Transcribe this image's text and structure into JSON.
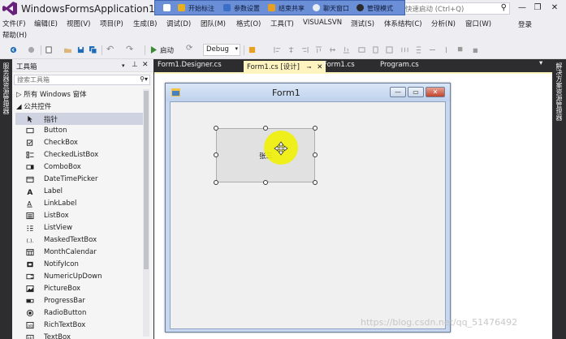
{
  "window": {
    "app_title": "WindowsFormsApplication1 - Mic",
    "quick_launch_placeholder": "快速启动 (Ctrl+Q)"
  },
  "overlay_toolbar": {
    "items": [
      "开始标注",
      "参数设置",
      "结束共享",
      "聊天窗口",
      "管理模式"
    ],
    "color": "#6b8fd6"
  },
  "menubar": {
    "items": [
      "文件(F)",
      "编辑(E)",
      "视图(V)",
      "项目(P)",
      "生成(B)",
      "调试(D)",
      "团队(M)",
      "格式(O)",
      "工具(T)",
      "VISUALSVN",
      "测试(S)",
      "体系结构(C)",
      "分析(N)",
      "窗口(W)"
    ],
    "help": "帮助(H)",
    "login": "登录"
  },
  "toolbar": {
    "start_label": "启动",
    "config_value": "Debug"
  },
  "left_strip": {
    "label": "服务器资源管理器"
  },
  "right_strip": {
    "label": "解决方案资源管理器"
  },
  "toolbox": {
    "title": "工具箱",
    "search_placeholder": "搜索工具箱",
    "categories": [
      "所有 Windows 窗体",
      "公共控件"
    ],
    "items": [
      {
        "label": "指针",
        "icon": "pointer-icon"
      },
      {
        "label": "Button",
        "icon": "button-icon"
      },
      {
        "label": "CheckBox",
        "icon": "checkbox-icon"
      },
      {
        "label": "CheckedListBox",
        "icon": "checkedlistbox-icon"
      },
      {
        "label": "ComboBox",
        "icon": "combobox-icon"
      },
      {
        "label": "DateTimePicker",
        "icon": "datetimepicker-icon"
      },
      {
        "label": "Label",
        "icon": "label-icon"
      },
      {
        "label": "LinkLabel",
        "icon": "linklabel-icon"
      },
      {
        "label": "ListBox",
        "icon": "listbox-icon"
      },
      {
        "label": "ListView",
        "icon": "listview-icon"
      },
      {
        "label": "MaskedTextBox",
        "icon": "maskedtextbox-icon"
      },
      {
        "label": "MonthCalendar",
        "icon": "monthcalendar-icon"
      },
      {
        "label": "NotifyIcon",
        "icon": "notifyicon-icon"
      },
      {
        "label": "NumericUpDown",
        "icon": "numericupdown-icon"
      },
      {
        "label": "PictureBox",
        "icon": "picturebox-icon"
      },
      {
        "label": "ProgressBar",
        "icon": "progressbar-icon"
      },
      {
        "label": "RadioButton",
        "icon": "radiobutton-icon"
      },
      {
        "label": "RichTextBox",
        "icon": "richtextbox-icon"
      },
      {
        "label": "TextBox",
        "icon": "textbox-icon"
      }
    ]
  },
  "doc_tabs": [
    {
      "label": "Form1.Designer.cs",
      "active": false
    },
    {
      "label": "Form1.cs [设计]",
      "active": true
    },
    {
      "label": "Form1.cs",
      "active": false
    },
    {
      "label": "Program.cs",
      "active": false
    }
  ],
  "designer": {
    "form_caption": "Form1",
    "button_text": "张三"
  },
  "watermark": "https://blog.csdn.net/qq_51476492",
  "colors": {
    "active_tab": "#fdf4bf",
    "highlight": "#f0f000",
    "dark_chrome": "#2d2d30"
  }
}
